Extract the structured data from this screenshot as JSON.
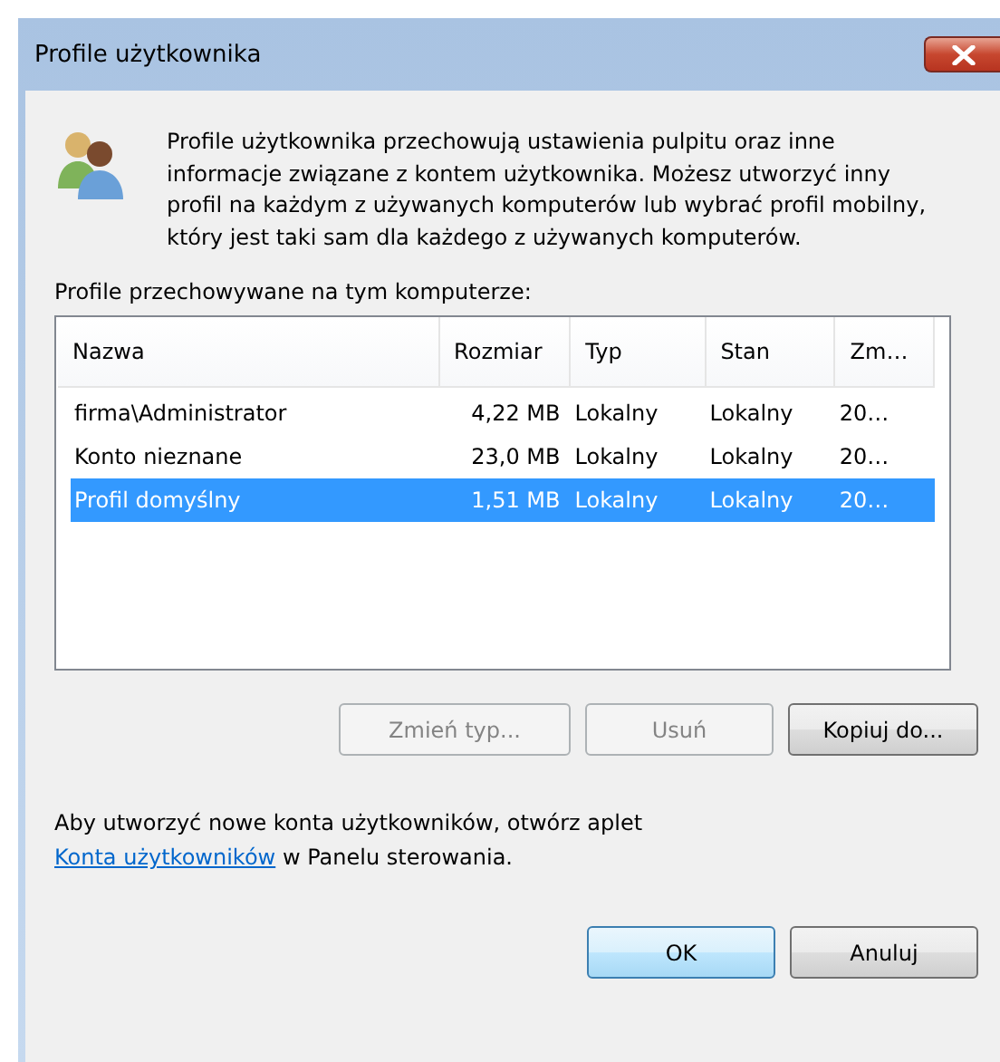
{
  "window": {
    "title": "Profile użytkownika"
  },
  "description": "Profile użytkownika przechowują ustawienia pulpitu oraz inne informacje związane z kontem użytkownika. Możesz utworzyć inny profil na każdym z używanych komputerów lub wybrać profil mobilny, który jest taki sam dla każdego z używanych komputerów.",
  "list_label": "Profile przechowywane na tym komputerze:",
  "table": {
    "columns": [
      "Nazwa",
      "Rozmiar",
      "Typ",
      "Stan",
      "Zm…"
    ],
    "rows": [
      {
        "cells": [
          "firma\\Administrator",
          "4,22 MB",
          "Lokalny",
          "Lokalny",
          "20…"
        ],
        "selected": false
      },
      {
        "cells": [
          "Konto nieznane",
          "23,0 MB",
          "Lokalny",
          "Lokalny",
          "20…"
        ],
        "selected": false
      },
      {
        "cells": [
          "Profil domyślny",
          "1,51 MB",
          "Lokalny",
          "Lokalny",
          "20…"
        ],
        "selected": true
      }
    ]
  },
  "profile_buttons": [
    {
      "label": "Zmień typ...",
      "disabled": true
    },
    {
      "label": "Usuń",
      "disabled": true
    },
    {
      "label": "Kopiuj do...",
      "disabled": false
    }
  ],
  "note": {
    "before": "Aby utworzyć nowe konta użytkowników, otwórz aplet",
    "link": "Konta użytkowników",
    "after": "w Panelu sterowania."
  },
  "dialog_buttons": [
    {
      "label": "OK",
      "default": true
    },
    {
      "label": "Anuluj",
      "default": false
    }
  ]
}
